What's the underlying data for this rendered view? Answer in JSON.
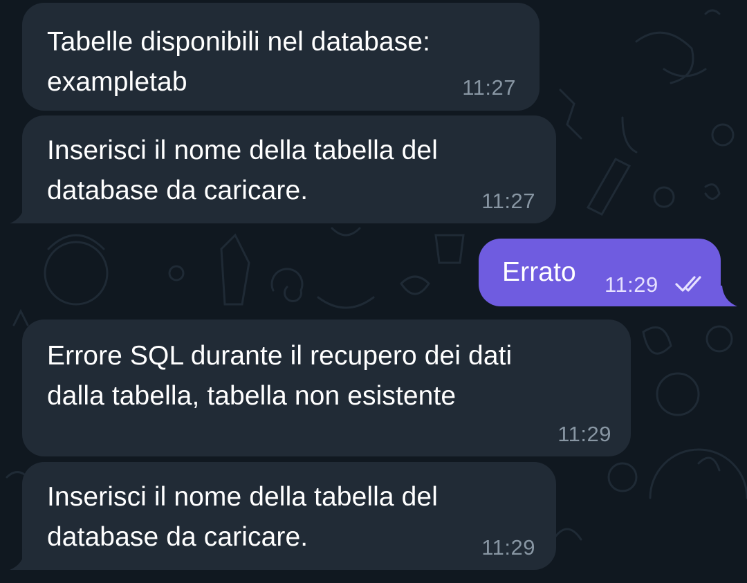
{
  "chat": {
    "messages": [
      {
        "direction": "incoming",
        "text": "Tabelle disponibili nel database:\nexampletab",
        "time": "11:27"
      },
      {
        "direction": "incoming",
        "text": "Inserisci il nome della tabella del\ndatabase da caricare.",
        "time": "11:27"
      },
      {
        "direction": "outgoing",
        "text": "Errato",
        "time": "11:29",
        "status": "read",
        "status_icon": "double-check-icon"
      },
      {
        "direction": "incoming",
        "text": "Errore SQL durante il recupero dei dati\ndalla tabella, tabella non esistente",
        "time": "11:29"
      },
      {
        "direction": "incoming",
        "text": "Inserisci il nome della tabella del\ndatabase da caricare.",
        "time": "11:29"
      }
    ]
  },
  "colors": {
    "background": "#101820",
    "incoming_bubble": "#212b36",
    "outgoing_bubble": "#6f5ce0",
    "timestamp": "#8896a3"
  }
}
